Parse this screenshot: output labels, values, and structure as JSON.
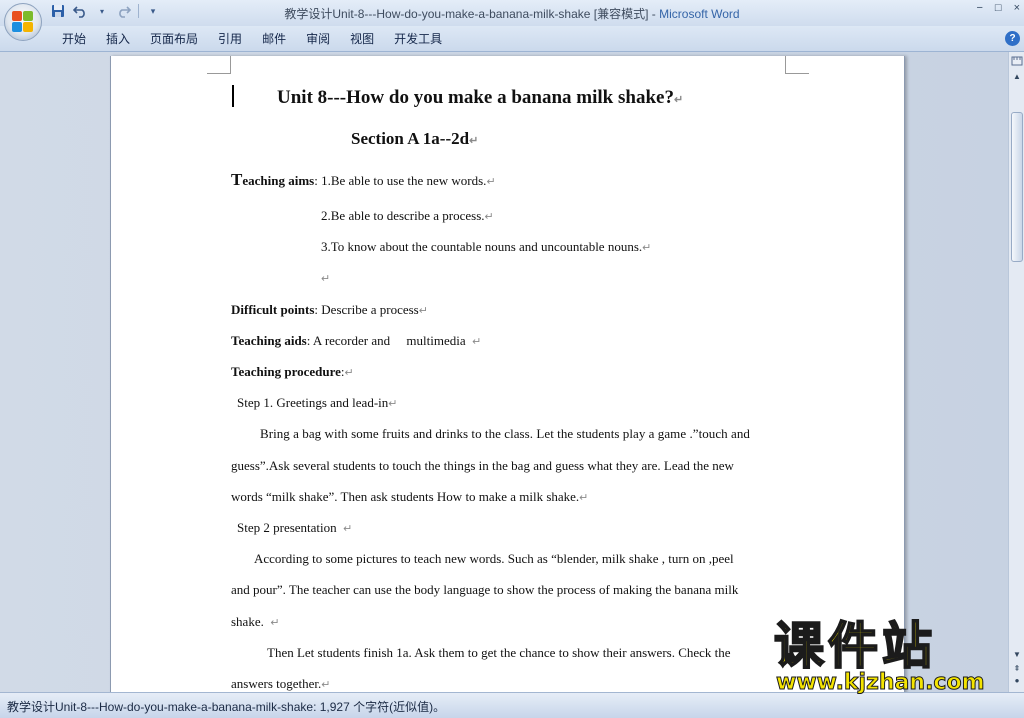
{
  "window": {
    "title": "教学设计Unit-8---How-do-you-make-a-banana-milk-shake [兼容模式]",
    "title_sep": " - ",
    "app_name": "Microsoft Word",
    "minimize": "−",
    "restore": "□",
    "close": "×"
  },
  "qat": {
    "save_icon": "save-icon",
    "undo_icon": "undo-icon",
    "redo_icon": "redo-icon",
    "customize_icon": "customize-icon"
  },
  "ribbon": {
    "tabs": [
      "开始",
      "插入",
      "页面布局",
      "引用",
      "邮件",
      "审阅",
      "视图",
      "开发工具"
    ],
    "help": "?"
  },
  "document": {
    "title": "Unit  8---How  do  you  make  a  banana  milk  shake?",
    "section": "Section A    1a--2d",
    "aims_label_first": "T",
    "aims_label_rest": "eaching aims",
    "aims_1": ": 1.Be able to use the new words.",
    "aims_2": "2.Be able to describe a process.",
    "aims_3": "3.To know about the countable nouns and uncountable nouns.",
    "difficult_label": "Difficult points",
    "difficult_text": ": Describe a process",
    "aids_label": "Teaching aids",
    "aids_text": ": A recorder and     multimedia  ",
    "procedure_label": "Teaching procedure",
    "procedure_text": ":",
    "step1": "Step 1. Greetings and lead-in",
    "step1_p1": "Bring a bag with some fruits and drinks to the class. Let the students play a game .”touch and",
    "step1_p2": "guess”.Ask several students to touch the things in the bag and guess what they are. Lead the new",
    "step1_p3": "words “milk shake”. Then ask students How to make a milk shake.",
    "step2": "Step 2 presentation  ",
    "step2_p1": "According to some pictures to teach new words. Such as “blender, milk shake , turn on ,peel",
    "step2_p2": "and pour”. The teacher can use the body language to show the process of making the banana milk",
    "step2_p3": "shake.  ",
    "step2_p4": "Then Let students finish 1a. Ask them to get the chance to show their answers. Check the",
    "step2_p5": "answers together.",
    "para_mark": "↵"
  },
  "statusbar": {
    "text": "教学设计Unit-8---How-do-you-make-a-banana-milk-shake: 1,927 个字符(近似值)。"
  },
  "watermark": {
    "cn": "课件站",
    "url": "www.kjzhan.com"
  }
}
